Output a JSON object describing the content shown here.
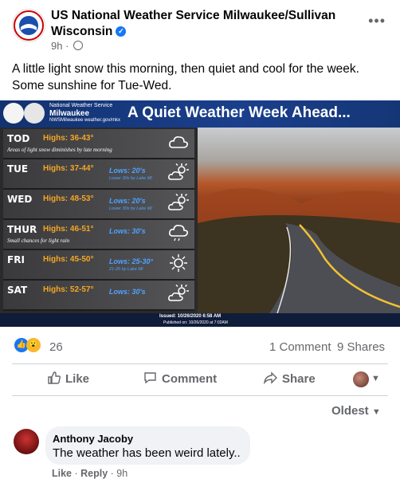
{
  "post": {
    "page_name": "US National Weather Service Milwaukee/Sullivan Wisconsin",
    "time": "9h",
    "caption": "A little light snow this morning, then quiet and cool for the week. Some sunshine for Tue-Wed."
  },
  "graphic": {
    "agency": "National Weather Service",
    "office": "Milwaukee",
    "social": "NWSMilwaukee weather.gov/mkx",
    "title": "A Quiet Weather Week Ahead...",
    "issued": "Issued: 10/26/2020 6:58 AM",
    "published": "Published on: 10/26/2020 at 7:02AM",
    "days": [
      {
        "name": "TOD",
        "high": "Highs: 36-43°",
        "low": "",
        "low_sub": "",
        "note": "Areas of light snow diminishes by late morning",
        "icon": "cloud-icon"
      },
      {
        "name": "TUE",
        "high": "Highs: 37-44°",
        "low": "Lows: 20's",
        "low_sub": "Lower 30s by Lake MI",
        "note": "",
        "icon": "partly-sunny-icon"
      },
      {
        "name": "WED",
        "high": "Highs: 48-53°",
        "low": "Lows: 20's",
        "low_sub": "Lower 30s by Lake MI",
        "note": "",
        "icon": "partly-sunny-icon"
      },
      {
        "name": "THUR",
        "high": "Highs: 46-51°",
        "low": "Lows: 30's",
        "low_sub": "",
        "note": "Small chances for light rain",
        "icon": "rain-cloud-icon"
      },
      {
        "name": "FRI",
        "high": "Highs: 45-50°",
        "low": "Lows: 25-30°",
        "low_sub": "21-26 by Lake MI",
        "note": "",
        "icon": "sun-icon"
      },
      {
        "name": "SAT",
        "high": "Highs: 52-57°",
        "low": "Lows: 30's",
        "low_sub": "",
        "note": "",
        "icon": "partly-sunny-icon"
      }
    ]
  },
  "stats": {
    "reactions_count": "26",
    "comments": "1 Comment",
    "shares": "9 Shares"
  },
  "actions": {
    "like": "Like",
    "comment": "Comment",
    "share": "Share"
  },
  "sort": {
    "selected": "Oldest"
  },
  "comment": {
    "author": "Anthony Jacoby",
    "text": "The weather has been weird lately..",
    "like": "Like",
    "reply": "Reply",
    "time": "9h"
  },
  "colors": {
    "facebook_blue": "#1877f2",
    "highs": "#f5a623",
    "lows": "#4fa3ff",
    "banner": "#1a3f8c"
  }
}
